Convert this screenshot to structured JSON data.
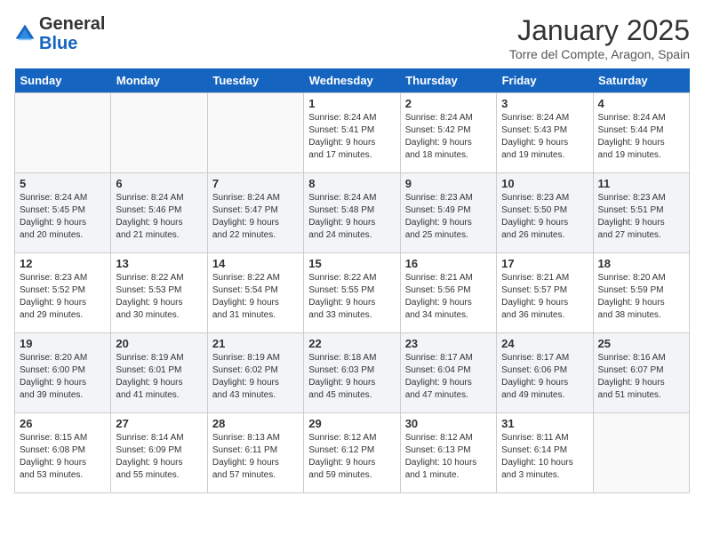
{
  "logo": {
    "general": "General",
    "blue": "Blue"
  },
  "header": {
    "title": "January 2025",
    "subtitle": "Torre del Compte, Aragon, Spain"
  },
  "days_of_week": [
    "Sunday",
    "Monday",
    "Tuesday",
    "Wednesday",
    "Thursday",
    "Friday",
    "Saturday"
  ],
  "weeks": [
    [
      {
        "day": "",
        "info": ""
      },
      {
        "day": "",
        "info": ""
      },
      {
        "day": "",
        "info": ""
      },
      {
        "day": "1",
        "info": "Sunrise: 8:24 AM\nSunset: 5:41 PM\nDaylight: 9 hours\nand 17 minutes."
      },
      {
        "day": "2",
        "info": "Sunrise: 8:24 AM\nSunset: 5:42 PM\nDaylight: 9 hours\nand 18 minutes."
      },
      {
        "day": "3",
        "info": "Sunrise: 8:24 AM\nSunset: 5:43 PM\nDaylight: 9 hours\nand 19 minutes."
      },
      {
        "day": "4",
        "info": "Sunrise: 8:24 AM\nSunset: 5:44 PM\nDaylight: 9 hours\nand 19 minutes."
      }
    ],
    [
      {
        "day": "5",
        "info": "Sunrise: 8:24 AM\nSunset: 5:45 PM\nDaylight: 9 hours\nand 20 minutes."
      },
      {
        "day": "6",
        "info": "Sunrise: 8:24 AM\nSunset: 5:46 PM\nDaylight: 9 hours\nand 21 minutes."
      },
      {
        "day": "7",
        "info": "Sunrise: 8:24 AM\nSunset: 5:47 PM\nDaylight: 9 hours\nand 22 minutes."
      },
      {
        "day": "8",
        "info": "Sunrise: 8:24 AM\nSunset: 5:48 PM\nDaylight: 9 hours\nand 24 minutes."
      },
      {
        "day": "9",
        "info": "Sunrise: 8:23 AM\nSunset: 5:49 PM\nDaylight: 9 hours\nand 25 minutes."
      },
      {
        "day": "10",
        "info": "Sunrise: 8:23 AM\nSunset: 5:50 PM\nDaylight: 9 hours\nand 26 minutes."
      },
      {
        "day": "11",
        "info": "Sunrise: 8:23 AM\nSunset: 5:51 PM\nDaylight: 9 hours\nand 27 minutes."
      }
    ],
    [
      {
        "day": "12",
        "info": "Sunrise: 8:23 AM\nSunset: 5:52 PM\nDaylight: 9 hours\nand 29 minutes."
      },
      {
        "day": "13",
        "info": "Sunrise: 8:22 AM\nSunset: 5:53 PM\nDaylight: 9 hours\nand 30 minutes."
      },
      {
        "day": "14",
        "info": "Sunrise: 8:22 AM\nSunset: 5:54 PM\nDaylight: 9 hours\nand 31 minutes."
      },
      {
        "day": "15",
        "info": "Sunrise: 8:22 AM\nSunset: 5:55 PM\nDaylight: 9 hours\nand 33 minutes."
      },
      {
        "day": "16",
        "info": "Sunrise: 8:21 AM\nSunset: 5:56 PM\nDaylight: 9 hours\nand 34 minutes."
      },
      {
        "day": "17",
        "info": "Sunrise: 8:21 AM\nSunset: 5:57 PM\nDaylight: 9 hours\nand 36 minutes."
      },
      {
        "day": "18",
        "info": "Sunrise: 8:20 AM\nSunset: 5:59 PM\nDaylight: 9 hours\nand 38 minutes."
      }
    ],
    [
      {
        "day": "19",
        "info": "Sunrise: 8:20 AM\nSunset: 6:00 PM\nDaylight: 9 hours\nand 39 minutes."
      },
      {
        "day": "20",
        "info": "Sunrise: 8:19 AM\nSunset: 6:01 PM\nDaylight: 9 hours\nand 41 minutes."
      },
      {
        "day": "21",
        "info": "Sunrise: 8:19 AM\nSunset: 6:02 PM\nDaylight: 9 hours\nand 43 minutes."
      },
      {
        "day": "22",
        "info": "Sunrise: 8:18 AM\nSunset: 6:03 PM\nDaylight: 9 hours\nand 45 minutes."
      },
      {
        "day": "23",
        "info": "Sunrise: 8:17 AM\nSunset: 6:04 PM\nDaylight: 9 hours\nand 47 minutes."
      },
      {
        "day": "24",
        "info": "Sunrise: 8:17 AM\nSunset: 6:06 PM\nDaylight: 9 hours\nand 49 minutes."
      },
      {
        "day": "25",
        "info": "Sunrise: 8:16 AM\nSunset: 6:07 PM\nDaylight: 9 hours\nand 51 minutes."
      }
    ],
    [
      {
        "day": "26",
        "info": "Sunrise: 8:15 AM\nSunset: 6:08 PM\nDaylight: 9 hours\nand 53 minutes."
      },
      {
        "day": "27",
        "info": "Sunrise: 8:14 AM\nSunset: 6:09 PM\nDaylight: 9 hours\nand 55 minutes."
      },
      {
        "day": "28",
        "info": "Sunrise: 8:13 AM\nSunset: 6:11 PM\nDaylight: 9 hours\nand 57 minutes."
      },
      {
        "day": "29",
        "info": "Sunrise: 8:12 AM\nSunset: 6:12 PM\nDaylight: 9 hours\nand 59 minutes."
      },
      {
        "day": "30",
        "info": "Sunrise: 8:12 AM\nSunset: 6:13 PM\nDaylight: 10 hours\nand 1 minute."
      },
      {
        "day": "31",
        "info": "Sunrise: 8:11 AM\nSunset: 6:14 PM\nDaylight: 10 hours\nand 3 minutes."
      },
      {
        "day": "",
        "info": ""
      }
    ]
  ]
}
